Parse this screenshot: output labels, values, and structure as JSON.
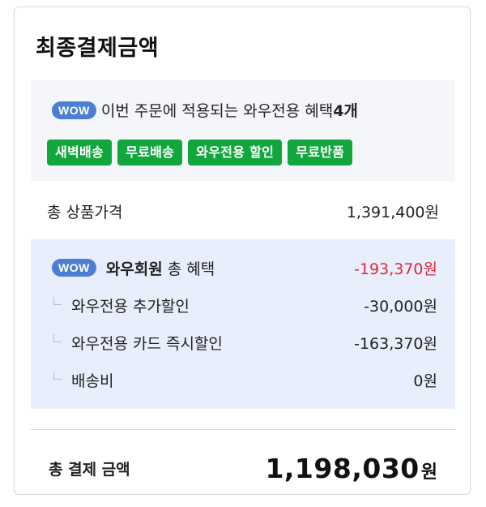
{
  "title": "최종결제금액",
  "wow": {
    "badge": "WOW",
    "text_prefix": "이번 주문에 적용되는 와우전용 혜택",
    "text_count": "4개",
    "tags": [
      "새벽배송",
      "무료배송",
      "와우전용 할인",
      "무료반품"
    ]
  },
  "product_total": {
    "label": "총 상품가격",
    "value": "1,391,400원"
  },
  "benefits": {
    "badge": "WOW",
    "label_bold": "와우회원",
    "label_rest": "총 혜택",
    "value": "-193,370원",
    "items": [
      {
        "label": "와우전용 추가할인",
        "value": "-30,000원"
      },
      {
        "label": "와우전용 카드 즉시할인",
        "value": "-163,370원"
      },
      {
        "label": "배송비",
        "value": "0원"
      }
    ]
  },
  "final": {
    "label": "총 결제 금액",
    "amount": "1,198,030",
    "unit": "원"
  },
  "colors": {
    "wow_badge": "#4a7fd4",
    "tag_green": "#12a73c",
    "discount_red": "#e0283b",
    "benefit_bg": "#e8eefb",
    "wow_box_bg": "#f4f6f9"
  },
  "icons": {
    "sub_item": "corner-arrow-icon"
  }
}
